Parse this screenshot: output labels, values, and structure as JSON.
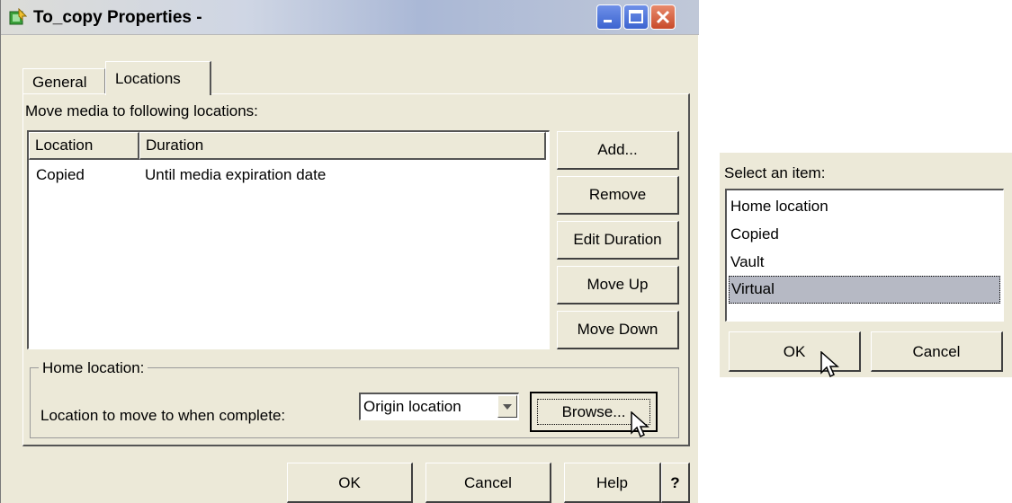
{
  "window": {
    "title": "To_copy Properties -"
  },
  "tabs": [
    {
      "label": "General"
    },
    {
      "label": "Locations"
    }
  ],
  "panel": {
    "instruction": "Move media to following locations:",
    "columns": {
      "location": "Location",
      "duration": "Duration"
    },
    "rows": [
      {
        "location": "Copied",
        "duration": "Until media expiration date"
      }
    ],
    "buttons": {
      "add": "Add...",
      "remove": "Remove",
      "edit_duration": "Edit Duration",
      "move_up": "Move Up",
      "move_down": "Move Down"
    }
  },
  "home": {
    "group_title": "Home location:",
    "label": "Location to move to when complete:",
    "selected": "Origin location",
    "browse": "Browse..."
  },
  "footer": {
    "ok": "OK",
    "cancel": "Cancel",
    "help": "Help",
    "help_icon": "?"
  },
  "select_dialog": {
    "title": "Select an item:",
    "items": [
      "Home location",
      "Copied",
      "Vault",
      "Virtual"
    ],
    "selected_item": "Virtual",
    "ok": "OK",
    "cancel": "Cancel"
  },
  "icons": {
    "app": "properties-icon",
    "minimize": "minimize-icon",
    "maximize": "maximize-icon",
    "close": "close-icon",
    "dropdown": "chevron-down-icon",
    "cursor": "mouse-pointer-icon"
  }
}
